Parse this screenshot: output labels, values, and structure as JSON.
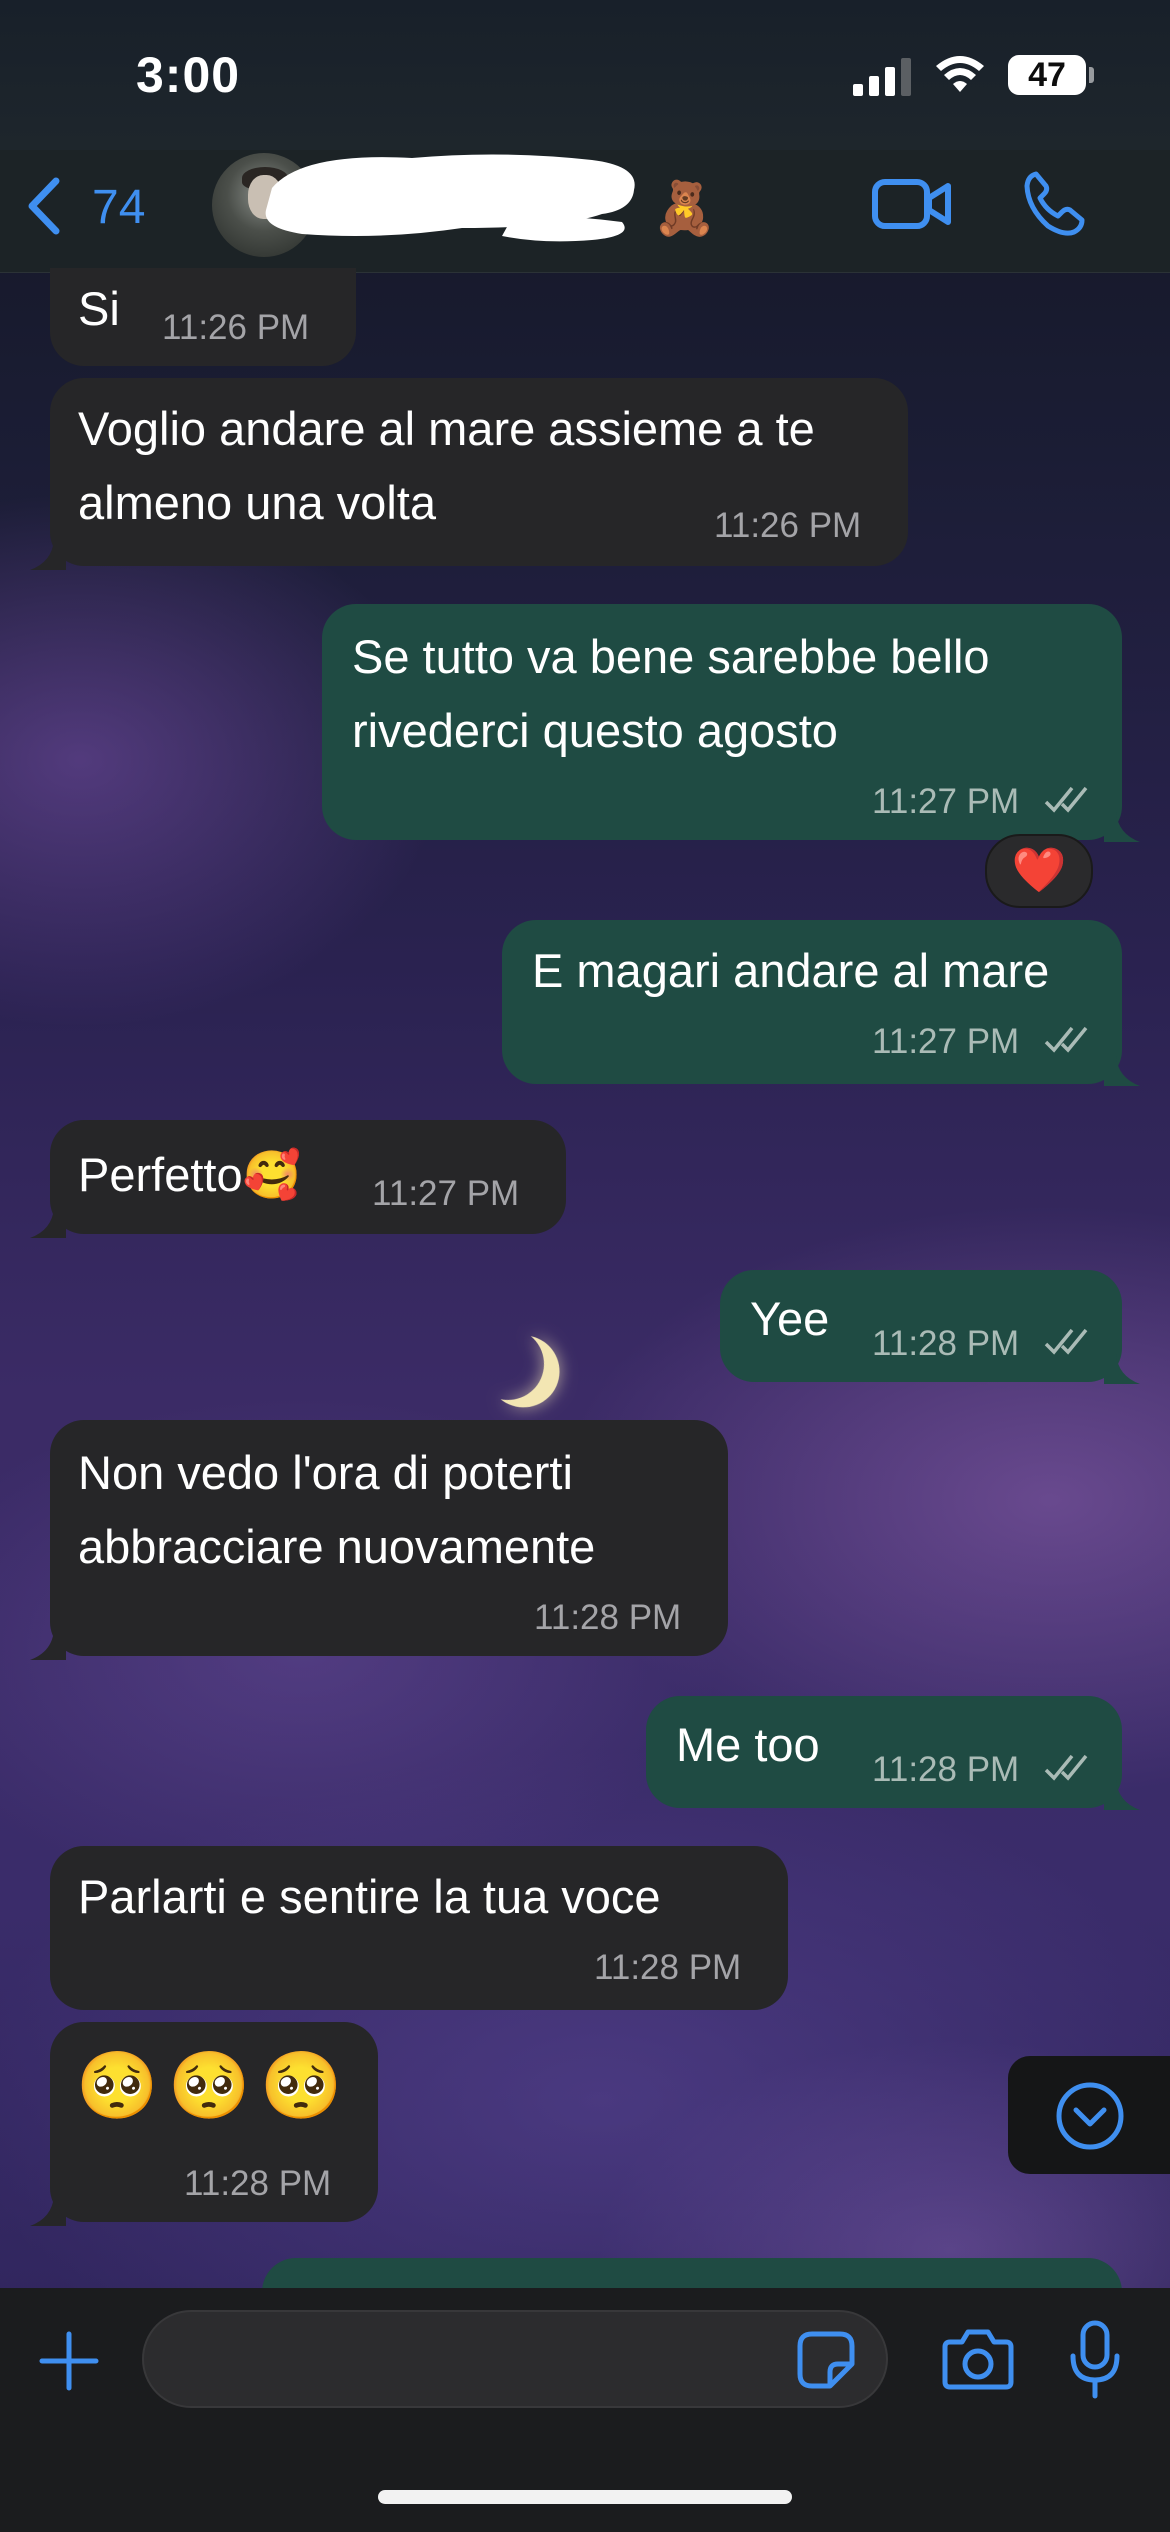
{
  "status_bar": {
    "time": "3:00",
    "battery": "47"
  },
  "header": {
    "back_count": "74",
    "contact_emoji": "🧸"
  },
  "messages": [
    {
      "direction": "in",
      "text": "Si",
      "time": "11:26 PM"
    },
    {
      "direction": "in",
      "lines": [
        "Voglio andare al mare assieme a te",
        "almeno una volta"
      ],
      "time": "11:26 PM"
    },
    {
      "direction": "out",
      "lines": [
        "Se tutto va bene sarebbe bello",
        "rivederci questo agosto"
      ],
      "time": "11:27 PM",
      "reaction": "❤️"
    },
    {
      "direction": "out",
      "text": "E magari andare al mare",
      "time": "11:27 PM"
    },
    {
      "direction": "in",
      "text": "Perfetto🥰",
      "time": "11:27 PM"
    },
    {
      "direction": "out",
      "text": "Yee",
      "time": "11:28 PM"
    },
    {
      "direction": "in",
      "lines": [
        "Non vedo l'ora di poterti",
        "abbracciare nuovamente"
      ],
      "time": "11:28 PM"
    },
    {
      "direction": "out",
      "text": "Me too",
      "time": "11:28 PM"
    },
    {
      "direction": "in",
      "text": "Parlarti e sentire la tua voce",
      "time": "11:28 PM"
    },
    {
      "direction": "in",
      "text": "🥺🥺🥺",
      "time": "11:28 PM"
    }
  ],
  "composer": {
    "placeholder": ""
  },
  "colors": {
    "accent": "#3f8ff0",
    "incoming_bubble": "#262628",
    "outgoing_bubble": "#1f4b43"
  }
}
